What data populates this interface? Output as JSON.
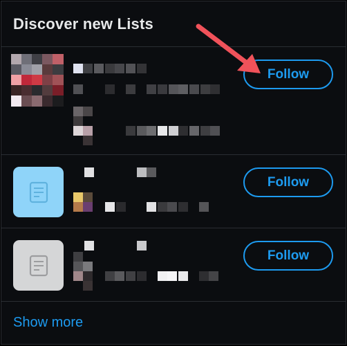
{
  "header": {
    "title": "Discover new Lists"
  },
  "lists": [
    {
      "follow_label": "Follow",
      "thumbnail": "mosaic-image"
    },
    {
      "follow_label": "Follow",
      "thumbnail": "list-icon",
      "thumb_color": "#8fd4f9"
    },
    {
      "follow_label": "Follow",
      "thumbnail": "list-icon",
      "thumb_color": "#d5d6d7"
    }
  ],
  "footer": {
    "show_more": "Show more"
  },
  "colors": {
    "accent": "#1d9bf0",
    "background": "#0b0d10",
    "annotation": "#f0525a"
  },
  "annotation": {
    "icon": "red-arrow-icon",
    "points_to": "first follow button"
  }
}
